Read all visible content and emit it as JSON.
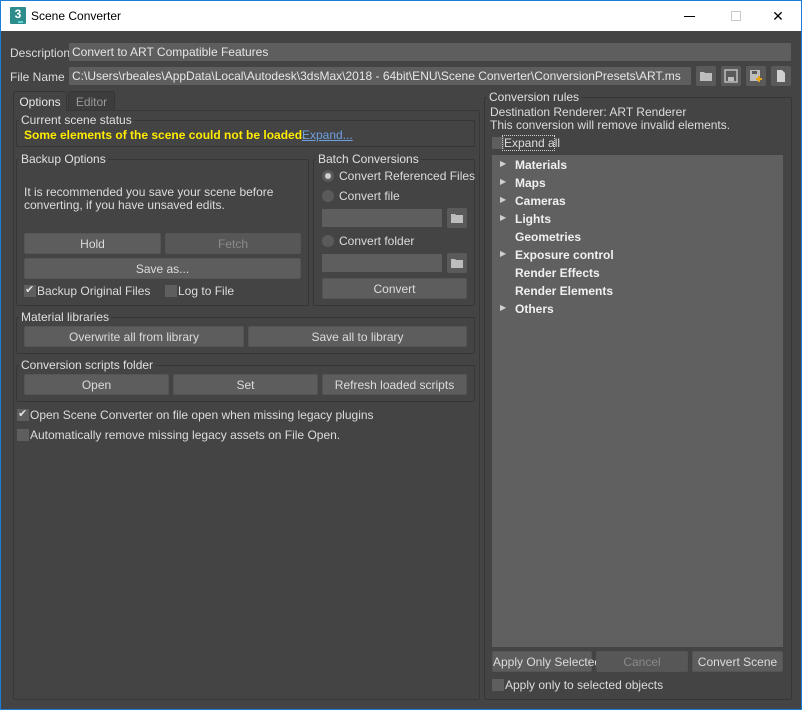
{
  "window": {
    "title": "Scene Converter",
    "controls": {
      "minimize": "minimize",
      "maximize": "maximize",
      "close": "close"
    }
  },
  "header": {
    "description_label": "Description",
    "description_value": "Convert to ART Compatible Features",
    "file_name_label": "File Name",
    "file_name_value": "C:\\Users\\rbeales\\AppData\\Local\\Autodesk\\3dsMax\\2018 - 64bit\\ENU\\Scene Converter\\ConversionPresets\\ART.ms",
    "file_icons": [
      "folder-open-icon",
      "save-icon",
      "save-as-icon",
      "new-file-icon"
    ]
  },
  "tabs": [
    {
      "label": "Options",
      "active": true
    },
    {
      "label": "Editor",
      "active": false
    }
  ],
  "scene_status": {
    "title": "Current scene status",
    "message": "Some elements of the scene could not be loaded.",
    "message_color": "#ffeb00",
    "link": "Expand..."
  },
  "backup": {
    "title": "Backup Options",
    "text_line1": "It is recommended you save your scene before",
    "text_line2": "converting, if you have unsaved edits.",
    "hold": "Hold",
    "fetch": "Fetch",
    "save_as": "Save as...",
    "backup_original": {
      "label": "Backup Original Files",
      "checked": true
    },
    "log_to_file": {
      "label": "Log to File",
      "checked": false
    }
  },
  "batch": {
    "title": "Batch Conversions",
    "options": [
      {
        "label": "Convert Referenced Files",
        "checked": true
      },
      {
        "label": "Convert file",
        "checked": false
      },
      {
        "label": "Convert folder",
        "checked": false
      }
    ],
    "file_value": "",
    "folder_value": "",
    "convert": "Convert"
  },
  "material_libraries": {
    "title": "Material libraries",
    "overwrite": "Overwrite all from library",
    "save_all": "Save all to library"
  },
  "scripts_folder": {
    "title": "Conversion scripts folder",
    "open": "Open",
    "set": "Set",
    "refresh": "Refresh loaded scripts"
  },
  "global_options": [
    {
      "label": "Open Scene Converter on file open when missing legacy plugins",
      "checked": true
    },
    {
      "label": "Automatically remove missing legacy assets on File Open.",
      "checked": false
    }
  ],
  "rules": {
    "title": "Conversion rules",
    "destination": "Destination Renderer: ART Renderer",
    "note": "This conversion will remove invalid elements.",
    "expand_all": {
      "label": "Expand all",
      "checked": false
    },
    "items": [
      {
        "label": "Materials",
        "expandable": true
      },
      {
        "label": "Maps",
        "expandable": true
      },
      {
        "label": "Cameras",
        "expandable": true
      },
      {
        "label": "Lights",
        "expandable": true
      },
      {
        "label": "Geometries",
        "expandable": false
      },
      {
        "label": "Exposure control",
        "expandable": true
      },
      {
        "label": "Render Effects",
        "expandable": false
      },
      {
        "label": "Render Elements",
        "expandable": false
      },
      {
        "label": "Others",
        "expandable": true
      }
    ],
    "apply_selected": "Apply Only Selected",
    "cancel": "Cancel",
    "convert_scene": "Convert Scene",
    "apply_only_objects": {
      "label": "Apply only to selected objects",
      "checked": false
    }
  }
}
